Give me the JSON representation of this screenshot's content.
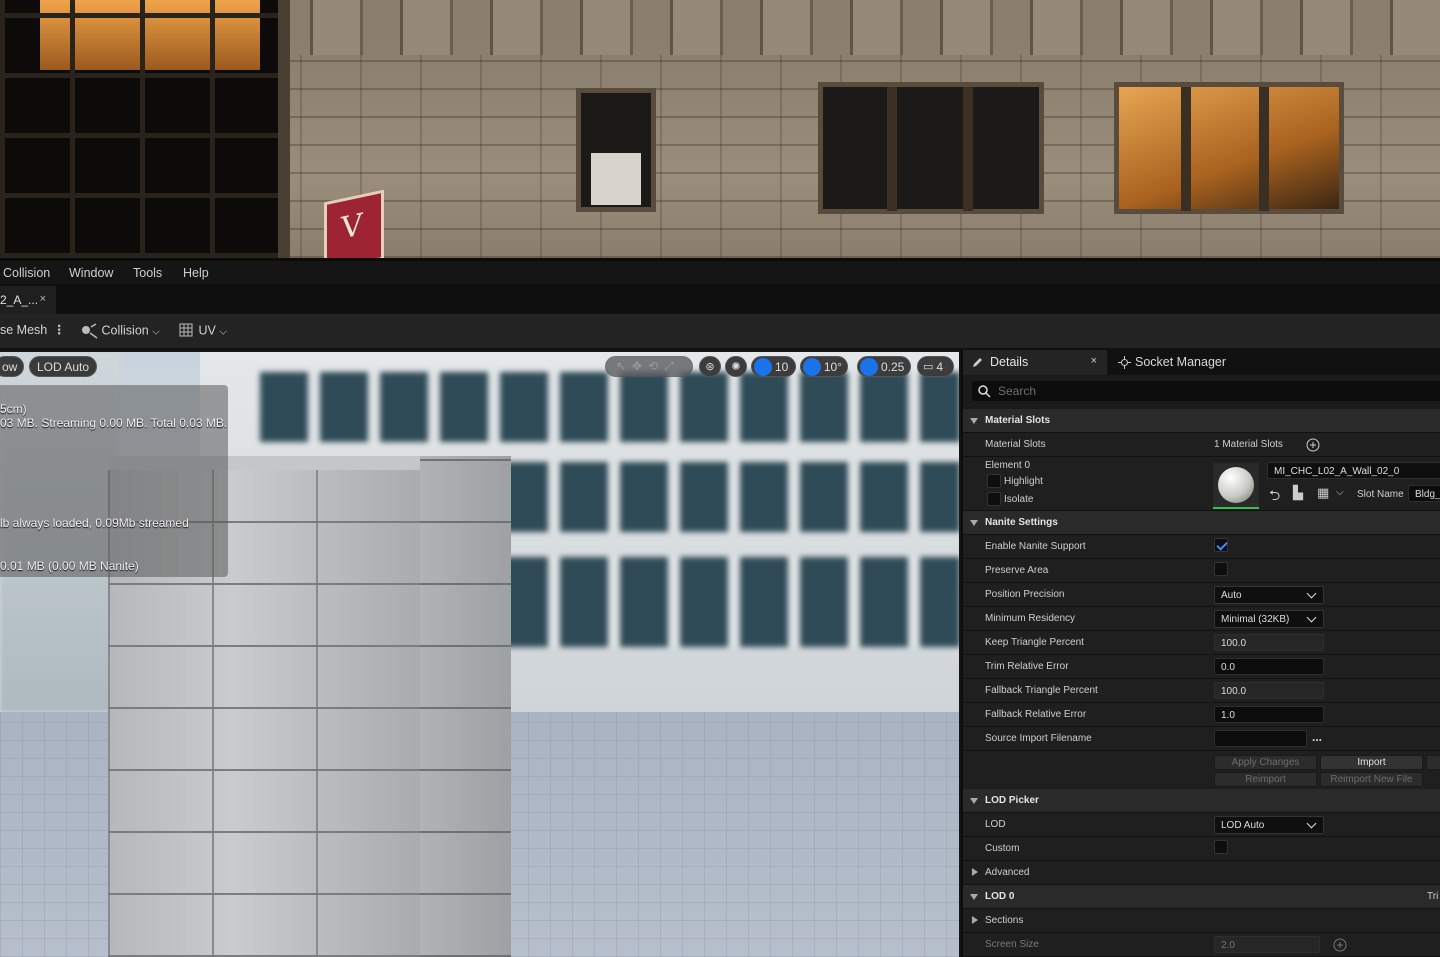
{
  "menubar": {
    "items": [
      "Collision",
      "Window",
      "Tools",
      "Help"
    ]
  },
  "tab": {
    "label": "2_A_...",
    "close": "×"
  },
  "toolbar": {
    "mesh_label": "se Mesh",
    "collision_label": "Collision",
    "uv_label": "UV"
  },
  "viewport": {
    "show_label": "ow",
    "lod_label": "LOD Auto",
    "grid_snap": "10",
    "rot_snap": "10°",
    "scale_snap": "0.25",
    "camera_speed": "4",
    "overlay_lines": [
      "5cm)",
      "03 MB. Streaming 0.00 MB. Total 0.03 MB.",
      "lb always loaded, 0.09Mb streamed",
      "0.01 MB (0.00 MB Nanite)"
    ]
  },
  "details": {
    "tab_title": "Details",
    "tab_close": "×",
    "socket_tab": "Socket Manager",
    "search_placeholder": "Search",
    "material_slots": {
      "section": "Material Slots",
      "label": "Material Slots",
      "count": "1 Material Slots",
      "element": "Element 0",
      "highlight": "Highlight",
      "isolate": "Isolate",
      "material_name": "MI_CHC_L02_A_Wall_02_0",
      "slot_name_label": "Slot Name",
      "slot_name_value": "Bldg_b"
    },
    "nanite": {
      "section": "Nanite Settings",
      "enable": "Enable Nanite Support",
      "enable_checked": true,
      "preserve_area": "Preserve Area",
      "preserve_checked": false,
      "position_precision": "Position Precision",
      "position_precision_value": "Auto",
      "min_residency": "Minimum Residency",
      "min_residency_value": "Minimal (32KB)",
      "keep_triangle": "Keep Triangle Percent",
      "keep_triangle_value": "100.0",
      "trim_error": "Trim Relative Error",
      "trim_error_value": "0.0",
      "fallback_triangle": "Fallback Triangle Percent",
      "fallback_triangle_value": "100.0",
      "fallback_error": "Fallback Relative Error",
      "fallback_error_value": "1.0",
      "source_import": "Source Import Filename",
      "source_import_value": "",
      "source_import_browse": "...",
      "apply_changes": "Apply Changes",
      "import": "Import",
      "reimport": "Reimport",
      "reimport_new": "Reimport New File"
    },
    "lod_picker": {
      "section": "LOD Picker",
      "lod": "LOD",
      "lod_value": "LOD Auto",
      "custom": "Custom",
      "custom_checked": false,
      "advanced": "Advanced"
    },
    "lod0": {
      "section": "LOD 0",
      "right_text": "Tri",
      "sections": "Sections",
      "screen_size": "Screen Size",
      "screen_size_value": "2.0"
    }
  }
}
